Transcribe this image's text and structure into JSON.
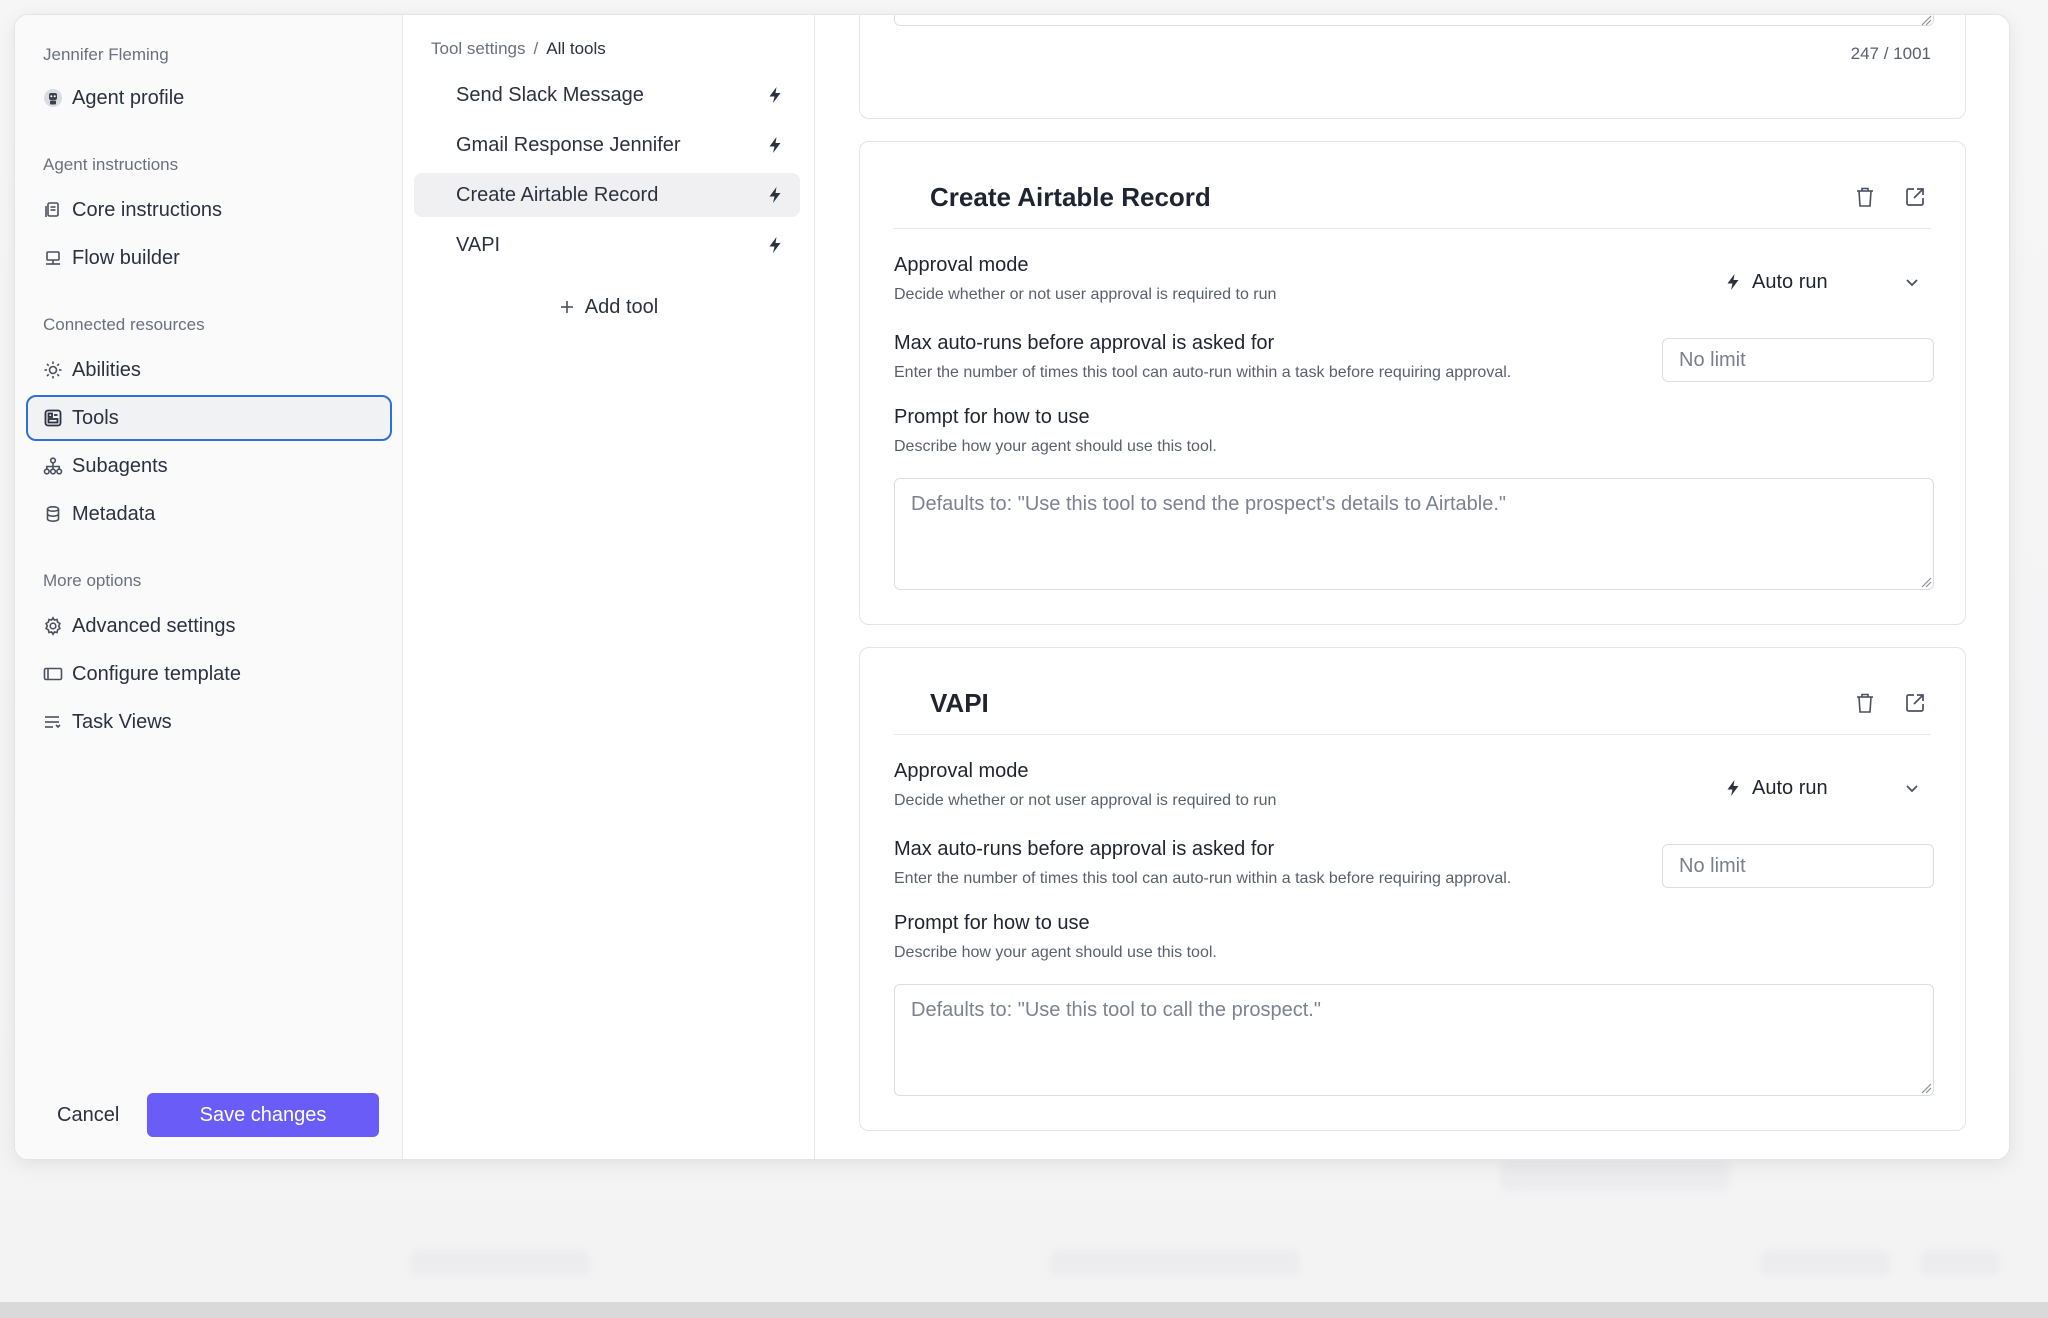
{
  "nav": {
    "user_name": "Jennifer Fleming",
    "agent_profile": "Agent profile",
    "section_instructions": "Agent instructions",
    "core_instructions": "Core instructions",
    "flow_builder": "Flow builder",
    "section_resources": "Connected resources",
    "abilities": "Abilities",
    "tools": "Tools",
    "subagents": "Subagents",
    "metadata": "Metadata",
    "section_more": "More options",
    "advanced_settings": "Advanced settings",
    "configure_template": "Configure template",
    "task_views": "Task Views"
  },
  "footer": {
    "cancel_label": "Cancel",
    "save_label": "Save changes"
  },
  "tools_list": {
    "breadcrumb_root": "Tool settings",
    "breadcrumb_sep": "/",
    "breadcrumb_current": "All tools",
    "items": [
      {
        "label": "Send Slack Message"
      },
      {
        "label": "Gmail Response Jennifer"
      },
      {
        "label": "Create Airtable Record"
      },
      {
        "label": "VAPI"
      }
    ],
    "active_index": 2,
    "add_label": "Add tool"
  },
  "detail": {
    "top_counter": "247 / 1001",
    "cards": [
      {
        "title": "Create Airtable Record",
        "approval_label": "Approval mode",
        "approval_help": "Decide whether or not user approval is required to run",
        "approval_value": "Auto run",
        "max_label": "Max auto-runs before approval is asked for",
        "max_help": "Enter the number of times this tool can auto-run within a task before requiring approval.",
        "max_placeholder": "No limit",
        "prompt_label": "Prompt for how to use",
        "prompt_help": "Describe how your agent should use this tool.",
        "prompt_placeholder": "Defaults to: \"Use this tool to send the prospect's details to Airtable.\""
      },
      {
        "title": "VAPI",
        "approval_label": "Approval mode",
        "approval_help": "Decide whether or not user approval is required to run",
        "approval_value": "Auto run",
        "max_label": "Max auto-runs before approval is asked for",
        "max_help": "Enter the number of times this tool can auto-run within a task before requiring approval.",
        "max_placeholder": "No limit",
        "prompt_label": "Prompt for how to use",
        "prompt_help": "Describe how your agent should use this tool.",
        "prompt_placeholder": "Defaults to: \"Use this tool to call the prospect.\""
      }
    ]
  },
  "colors": {
    "accent": "#6a5cf6",
    "focus_ring": "#2f6fd8"
  }
}
